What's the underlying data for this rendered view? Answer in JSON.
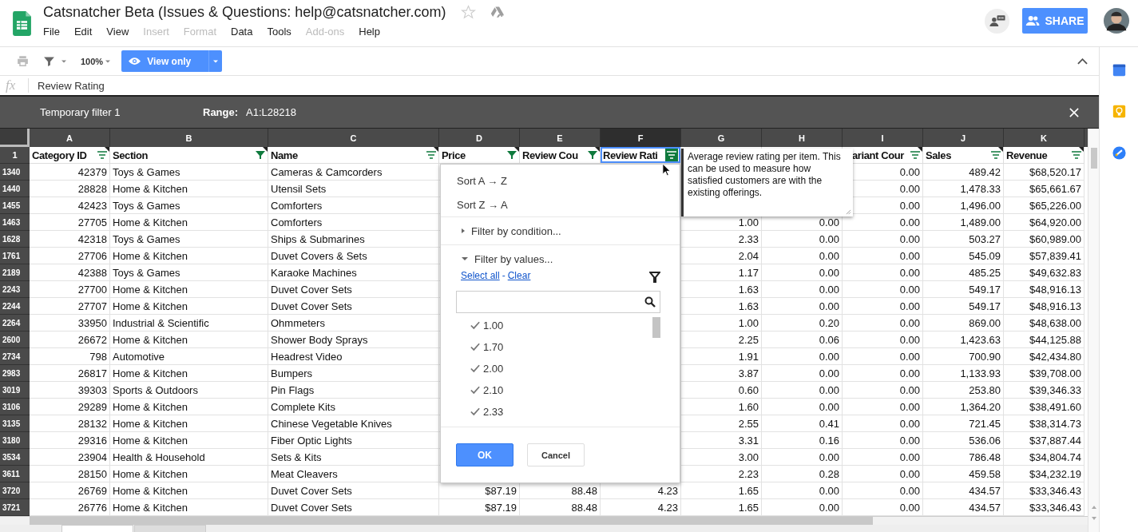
{
  "title": "Catsnatcher Beta (Issues & Questions: help@catsnatcher.com)",
  "menu": [
    {
      "label": "File",
      "disabled": false
    },
    {
      "label": "Edit",
      "disabled": false
    },
    {
      "label": "View",
      "disabled": false
    },
    {
      "label": "Insert",
      "disabled": true
    },
    {
      "label": "Format",
      "disabled": true
    },
    {
      "label": "Data",
      "disabled": false
    },
    {
      "label": "Tools",
      "disabled": false
    },
    {
      "label": "Add-ons",
      "disabled": true
    },
    {
      "label": "Help",
      "disabled": false
    }
  ],
  "share_label": "SHARE",
  "toolbar": {
    "zoom": "100%",
    "mode": "View only"
  },
  "formula_label": "fx",
  "formula": "Review Rating",
  "filter_bar": {
    "name": "Temporary filter 1",
    "range_label": "Range:",
    "range": "A1:L28218"
  },
  "columns": [
    {
      "letter": "A",
      "selected": false
    },
    {
      "letter": "B",
      "selected": false
    },
    {
      "letter": "C",
      "selected": false
    },
    {
      "letter": "D",
      "selected": false
    },
    {
      "letter": "E",
      "selected": false
    },
    {
      "letter": "F",
      "selected": true
    },
    {
      "letter": "G",
      "selected": false
    },
    {
      "letter": "H",
      "selected": false
    },
    {
      "letter": "I",
      "selected": false
    },
    {
      "letter": "J",
      "selected": false
    },
    {
      "letter": "K",
      "selected": false
    }
  ],
  "header_row": "1",
  "headers": [
    {
      "label": "Category ID",
      "filtered": false,
      "selected": false,
      "note": true
    },
    {
      "label": "Section",
      "filtered": true,
      "selected": false,
      "note": true
    },
    {
      "label": "Name",
      "filtered": false,
      "selected": false,
      "note": true
    },
    {
      "label": "Price",
      "filtered": true,
      "selected": false,
      "note": true
    },
    {
      "label": "Review Cou",
      "filtered": true,
      "selected": false,
      "note": true
    },
    {
      "label": "Review Rati",
      "filtered": false,
      "selected": true,
      "note": false
    },
    {
      "label": "ariant Cour",
      "filtered": false,
      "selected": false,
      "note": true
    },
    {
      "label": "Sales",
      "filtered": false,
      "selected": false,
      "note": true
    },
    {
      "label": "Revenue",
      "filtered": false,
      "selected": false,
      "note": true
    }
  ],
  "rows": [
    {
      "row": "1340",
      "cells": [
        "42379",
        "Toys & Games",
        "Cameras & Camcorders",
        null,
        null,
        null,
        null,
        null,
        "0.00",
        "489.42",
        "$68,520.17"
      ]
    },
    {
      "row": "1440",
      "cells": [
        "28828",
        "Home & Kitchen",
        "Utensil Sets",
        null,
        null,
        null,
        null,
        null,
        "0.00",
        "1,478.33",
        "$65,661.67"
      ]
    },
    {
      "row": "1455",
      "cells": [
        "42423",
        "Toys & Games",
        "Comforters",
        null,
        null,
        null,
        null,
        null,
        "0.00",
        "1,496.00",
        "$65,226.00"
      ]
    },
    {
      "row": "1463",
      "cells": [
        "27705",
        "Home & Kitchen",
        "Comforters",
        null,
        null,
        null,
        "1.00",
        "0.00",
        "0.00",
        "1,489.00",
        "$64,920.00"
      ]
    },
    {
      "row": "1628",
      "cells": [
        "42318",
        "Toys & Games",
        "Ships & Submarines",
        null,
        null,
        null,
        "2.33",
        "0.00",
        "0.00",
        "503.27",
        "$60,989.00"
      ]
    },
    {
      "row": "1761",
      "cells": [
        "27706",
        "Home & Kitchen",
        "Duvet Covers & Sets",
        null,
        null,
        null,
        "2.04",
        "0.00",
        "0.00",
        "545.09",
        "$57,839.41"
      ]
    },
    {
      "row": "2189",
      "cells": [
        "42388",
        "Toys & Games",
        "Karaoke Machines",
        null,
        null,
        null,
        "1.17",
        "0.00",
        "0.00",
        "485.25",
        "$49,632.83"
      ]
    },
    {
      "row": "2243",
      "cells": [
        "27700",
        "Home & Kitchen",
        "Duvet Cover Sets",
        null,
        null,
        null,
        "1.63",
        "0.00",
        "0.00",
        "549.17",
        "$48,916.13"
      ]
    },
    {
      "row": "2244",
      "cells": [
        "27707",
        "Home & Kitchen",
        "Duvet Cover Sets",
        null,
        null,
        null,
        "1.63",
        "0.00",
        "0.00",
        "549.17",
        "$48,916.13"
      ]
    },
    {
      "row": "2264",
      "cells": [
        "33950",
        "Industrial & Scientific",
        "Ohmmeters",
        null,
        null,
        null,
        "1.00",
        "0.20",
        "0.00",
        "869.00",
        "$48,638.00"
      ]
    },
    {
      "row": "2600",
      "cells": [
        "26672",
        "Home & Kitchen",
        "Shower Body Sprays",
        null,
        null,
        null,
        "2.25",
        "0.06",
        "0.00",
        "1,423.63",
        "$44,125.88"
      ]
    },
    {
      "row": "2734",
      "cells": [
        "798",
        "Automotive",
        "Headrest Video",
        null,
        null,
        null,
        "1.91",
        "0.00",
        "0.00",
        "700.90",
        "$42,434.80"
      ]
    },
    {
      "row": "2983",
      "cells": [
        "26817",
        "Home & Kitchen",
        "Bumpers",
        null,
        null,
        null,
        "3.87",
        "0.00",
        "0.00",
        "1,133.93",
        "$39,708.00"
      ]
    },
    {
      "row": "3019",
      "cells": [
        "39303",
        "Sports & Outdoors",
        "Pin Flags",
        null,
        null,
        null,
        "0.60",
        "0.00",
        "0.00",
        "253.80",
        "$39,346.33"
      ]
    },
    {
      "row": "3106",
      "cells": [
        "29289",
        "Home & Kitchen",
        "Complete Kits",
        null,
        null,
        null,
        "1.60",
        "0.00",
        "0.00",
        "1,364.20",
        "$38,491.60"
      ]
    },
    {
      "row": "3135",
      "cells": [
        "28132",
        "Home & Kitchen",
        "Chinese Vegetable Knives",
        null,
        null,
        null,
        "2.55",
        "0.41",
        "0.00",
        "721.45",
        "$38,314.73"
      ]
    },
    {
      "row": "3180",
      "cells": [
        "29316",
        "Home & Kitchen",
        "Fiber Optic Lights",
        null,
        null,
        null,
        "3.31",
        "0.16",
        "0.00",
        "536.06",
        "$37,887.44"
      ]
    },
    {
      "row": "3534",
      "cells": [
        "23904",
        "Health & Household",
        "Sets & Kits",
        null,
        null,
        null,
        "3.00",
        "0.00",
        "0.00",
        "786.48",
        "$34,804.74"
      ]
    },
    {
      "row": "3611",
      "cells": [
        "28150",
        "Home & Kitchen",
        "Meat Cleavers",
        null,
        null,
        null,
        "2.23",
        "0.28",
        "0.00",
        "459.58",
        "$34,232.19"
      ]
    },
    {
      "row": "3720",
      "cells": [
        "26769",
        "Home & Kitchen",
        "Duvet Cover Sets",
        "$87.19",
        "88.48",
        "4.23",
        "1.65",
        "0.00",
        "0.00",
        "434.57",
        "$33,346.43"
      ]
    },
    {
      "row": "3721",
      "cells": [
        "26776",
        "Home & Kitchen",
        "Duvet Cover Sets",
        "$87.19",
        "88.48",
        "4.23",
        "1.65",
        "0.00",
        "0.00",
        "434.57",
        "$33,346.43"
      ]
    }
  ],
  "filter_menu": {
    "sort_asc": "Sort A → Z",
    "sort_desc": "Sort Z → A",
    "by_condition": {
      "label": "Filter by condition...",
      "expanded": false
    },
    "by_values": {
      "label": "Filter by values...",
      "expanded": true
    },
    "select_all": "Select all",
    "separator": "-",
    "clear": "Clear",
    "values": [
      {
        "label": "1.00",
        "checked": true
      },
      {
        "label": "1.70",
        "checked": true
      },
      {
        "label": "2.00",
        "checked": true
      },
      {
        "label": "2.10",
        "checked": true
      },
      {
        "label": "2.33",
        "checked": true
      }
    ],
    "ok": "OK",
    "cancel": "Cancel"
  },
  "note_popup": "Average review rating per item. This can be used to measure how satisfied customers are with the existing offerings.",
  "sheet_tabs": [
    {
      "selected": true
    },
    {
      "selected": false
    }
  ]
}
